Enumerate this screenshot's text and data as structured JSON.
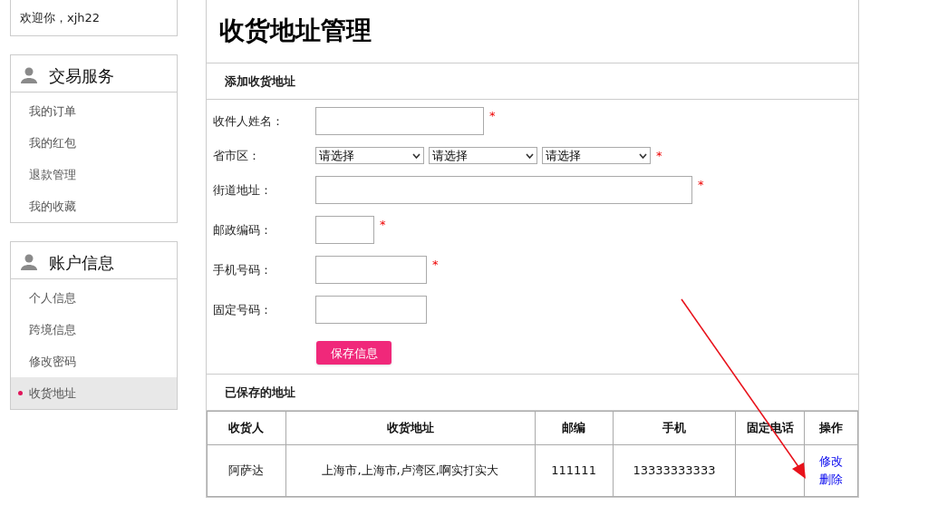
{
  "welcome": "欢迎你，xjh22",
  "sidebar": [
    {
      "title": "交易服务",
      "items": [
        {
          "label": "我的订单",
          "selected": false
        },
        {
          "label": "我的红包",
          "selected": false
        },
        {
          "label": "退款管理",
          "selected": false
        },
        {
          "label": "我的收藏",
          "selected": false
        }
      ]
    },
    {
      "title": "账户信息",
      "items": [
        {
          "label": "个人信息",
          "selected": false
        },
        {
          "label": "跨境信息",
          "selected": false
        },
        {
          "label": "修改密码",
          "selected": false
        },
        {
          "label": "收货地址",
          "selected": true
        }
      ]
    }
  ],
  "page_title": "收货地址管理",
  "form": {
    "title": "添加收货地址",
    "required_mark": "*",
    "fields": [
      {
        "label": "收件人姓名：",
        "kind": "text",
        "required": true
      },
      {
        "label": "省市区：",
        "kind": "select",
        "required": true,
        "options": [
          "请选择",
          "请选择",
          "请选择"
        ]
      },
      {
        "label": "街道地址：",
        "kind": "text",
        "required": true
      },
      {
        "label": "邮政编码：",
        "kind": "text",
        "required": true
      },
      {
        "label": "手机号码：",
        "kind": "text",
        "required": true
      },
      {
        "label": "固定号码：",
        "kind": "text",
        "required": false
      }
    ],
    "submit": "保存信息"
  },
  "saved": {
    "title": "已保存的地址",
    "columns": [
      "收货人",
      "收货地址",
      "邮编",
      "手机",
      "固定电话",
      "操作"
    ],
    "rows": [
      {
        "cells": [
          "阿萨达",
          "上海市,上海市,卢湾区,啊实打实大",
          "111111",
          "13333333333",
          ""
        ],
        "actions": [
          "修改",
          "删除"
        ]
      }
    ]
  }
}
